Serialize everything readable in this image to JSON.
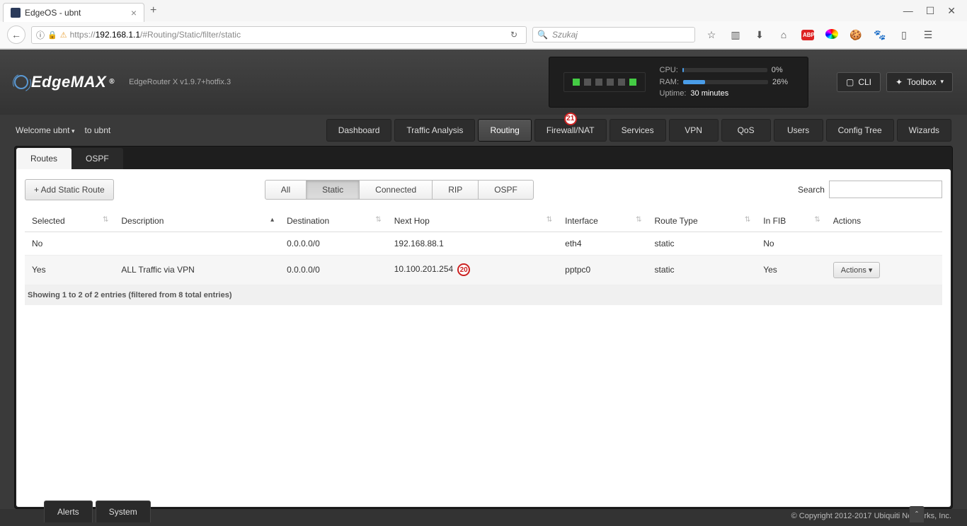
{
  "browser": {
    "tab_title": "EdgeOS - ubnt",
    "url_protocol": "https://",
    "url_domain": "192.168.1.1",
    "url_path": "/#Routing/Static/filter/static",
    "search_placeholder": "Szukaj"
  },
  "header": {
    "logo_text": "EdgeMAX",
    "model": "EdgeRouter X v1.9.7+hotfix.3",
    "cpu_label": "CPU:",
    "cpu_value": "0%",
    "cpu_pct": 2,
    "ram_label": "RAM:",
    "ram_value": "26%",
    "ram_pct": 26,
    "uptime_label": "Uptime:",
    "uptime_value": "30 minutes",
    "leds": [
      true,
      false,
      false,
      false,
      false,
      true
    ],
    "btn_cli": "CLI",
    "btn_toolbox": "Toolbox"
  },
  "welcome": {
    "welcome_text": "Welcome ubnt",
    "to_text": "to ubnt"
  },
  "nav": {
    "items": [
      "Dashboard",
      "Traffic Analysis",
      "Routing",
      "Firewall/NAT",
      "Services",
      "VPN",
      "QoS",
      "Users",
      "Config Tree",
      "Wizards"
    ],
    "active_index": 2,
    "badge_index": 3,
    "badge_text": "21"
  },
  "subtabs": {
    "items": [
      "Routes",
      "OSPF"
    ],
    "active_index": 0
  },
  "toolbar": {
    "add_button": "+  Add Static Route",
    "filters": [
      "All",
      "Static",
      "Connected",
      "RIP",
      "OSPF"
    ],
    "active_filter": 1,
    "search_label": "Search"
  },
  "table": {
    "columns": [
      "Selected",
      "Description",
      "Destination",
      "Next Hop",
      "Interface",
      "Route Type",
      "In FIB",
      "Actions"
    ],
    "sort_col": 1,
    "rows": [
      {
        "selected": "No",
        "description": "",
        "destination": "0.0.0.0/0",
        "nexthop": "192.168.88.1",
        "interface": "eth4",
        "routetype": "static",
        "infib": "No",
        "actions": "",
        "annot": ""
      },
      {
        "selected": "Yes",
        "description": "ALL Traffic via VPN",
        "destination": "0.0.0.0/0",
        "nexthop": "10.100.201.254",
        "interface": "pptpc0",
        "routetype": "static",
        "infib": "Yes",
        "actions": "Actions  ▾",
        "annot": "20"
      }
    ],
    "footer": "Showing 1 to 2 of 2 entries (filtered from 8 total entries)"
  },
  "footer": {
    "copyright": "© Copyright 2012-2017 Ubiquiti Networks, Inc."
  },
  "bottom": {
    "alerts": "Alerts",
    "system": "System",
    "collapse": "ˆ"
  }
}
